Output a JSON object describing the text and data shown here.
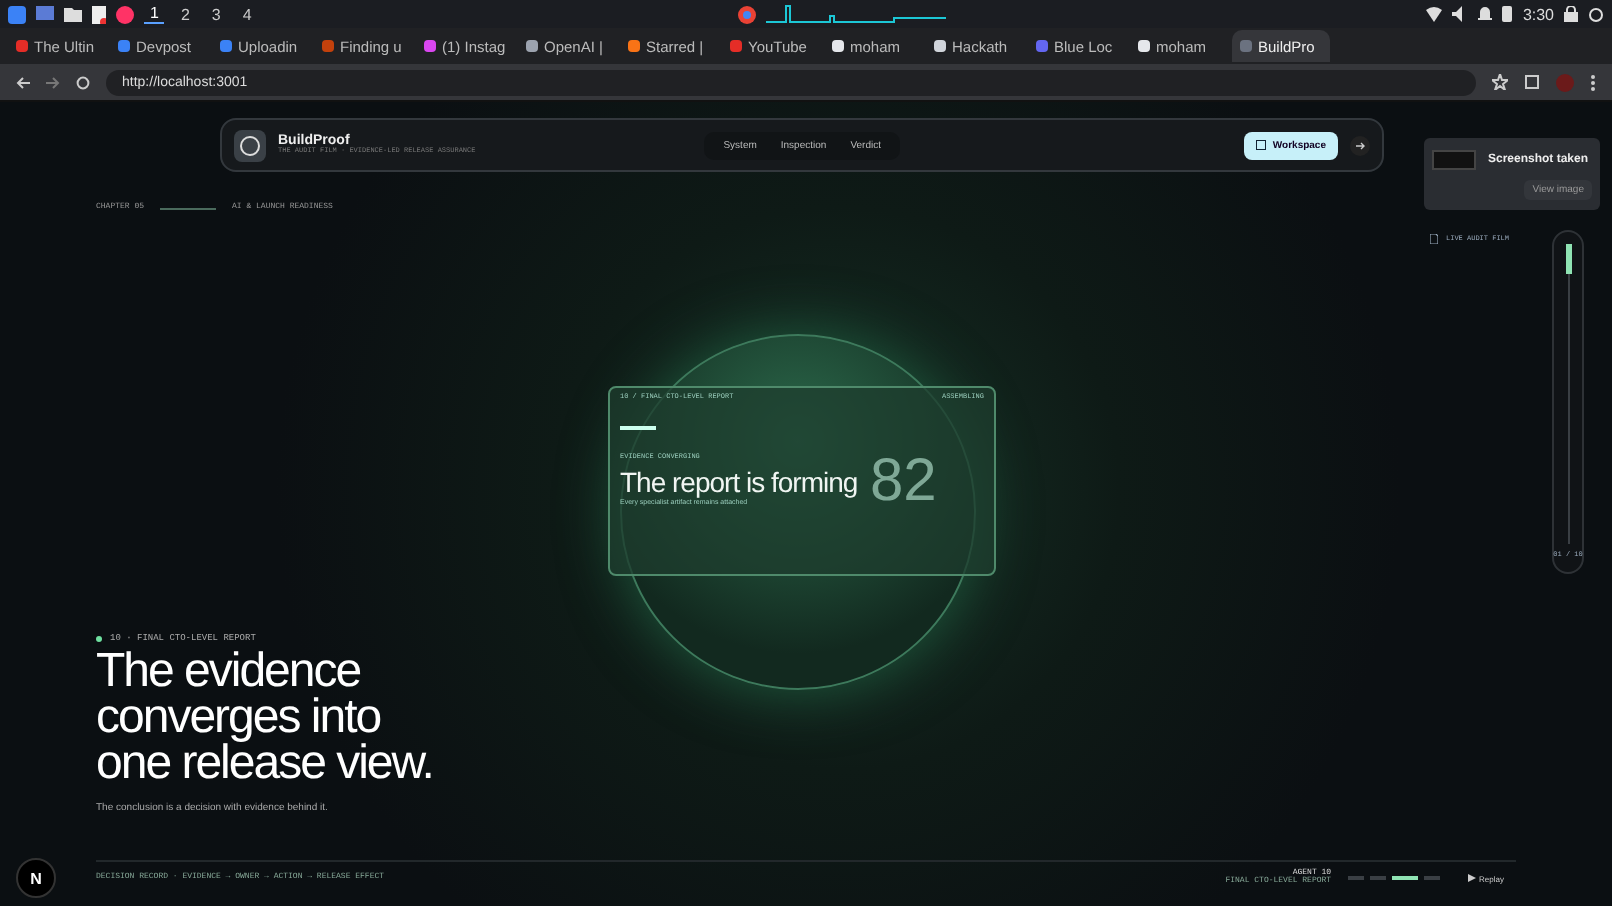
{
  "taskbar": {
    "workspaces": [
      {
        "label": "1",
        "selected": true
      },
      {
        "label": "2",
        "selected": false
      },
      {
        "label": "3",
        "selected": false
      },
      {
        "label": "4",
        "selected": false
      }
    ],
    "clock": "3:30"
  },
  "tabs": [
    {
      "title": "The Ultin",
      "color": "#e52d27",
      "selected": false
    },
    {
      "title": "Devpost",
      "color": "#3b82f6",
      "selected": false
    },
    {
      "title": "Uploadin",
      "color": "#3b82f6",
      "selected": false
    },
    {
      "title": "Finding u",
      "color": "#c2410c",
      "selected": false
    },
    {
      "title": "(1) Instag",
      "color": "#d946ef",
      "selected": false
    },
    {
      "title": "OpenAI |",
      "color": "#9ca3af",
      "selected": false
    },
    {
      "title": "Starred |",
      "color": "#f97316",
      "selected": false
    },
    {
      "title": "YouTube",
      "color": "#e52d27",
      "selected": false
    },
    {
      "title": "moham",
      "color": "#e5e7eb",
      "selected": false
    },
    {
      "title": "Hackath",
      "color": "#d1d5db",
      "selected": false
    },
    {
      "title": "Blue Loc",
      "color": "#6366f1",
      "selected": false
    },
    {
      "title": "moham",
      "color": "#e5e7eb",
      "selected": false
    },
    {
      "title": "BuildPro",
      "color": "#6b7280",
      "selected": true
    }
  ],
  "address": "http://localhost:3001",
  "nav": {
    "brand": "BuildProof",
    "tagline": "THE AUDIT FILM · EVIDENCE-LED RELEASE ASSURANCE",
    "links": [
      {
        "label": "System",
        "selected": false
      },
      {
        "label": "Inspection",
        "selected": false
      },
      {
        "label": "Verdict",
        "selected": false
      }
    ],
    "workspace": "Workspace"
  },
  "chapter": {
    "number": "CHAPTER 05",
    "title": "AI & LAUNCH READINESS"
  },
  "report_card": {
    "header": "10 / FINAL CTO-LEVEL REPORT",
    "status": "ASSEMBLING",
    "eyebrow": "EVIDENCE CONVERGING",
    "score": "82",
    "title": "The report is forming",
    "subtitle": "Every specialist artifact remains attached"
  },
  "hero": {
    "eyebrow": "10 · FINAL CTO-LEVEL REPORT",
    "heading": "The evidence converges into one release view.",
    "subtitle": "The conclusion is a decision with evidence behind it."
  },
  "toast": {
    "title": "Screenshot taken",
    "action": "View image"
  },
  "live_label": "LIVE AUDIT FILM",
  "rail": {
    "level": 0.1,
    "counter": "01 / 10"
  },
  "footer": {
    "record": "DECISION RECORD · EVIDENCE → OWNER → ACTION → RELEASE EFFECT",
    "agent": "AGENT 10",
    "agent_title": "FINAL CTO-LEVEL REPORT",
    "segments": [
      {
        "selected": false
      },
      {
        "selected": false
      },
      {
        "selected": true
      },
      {
        "selected": false
      }
    ],
    "replay": "Replay"
  },
  "badge": "N"
}
